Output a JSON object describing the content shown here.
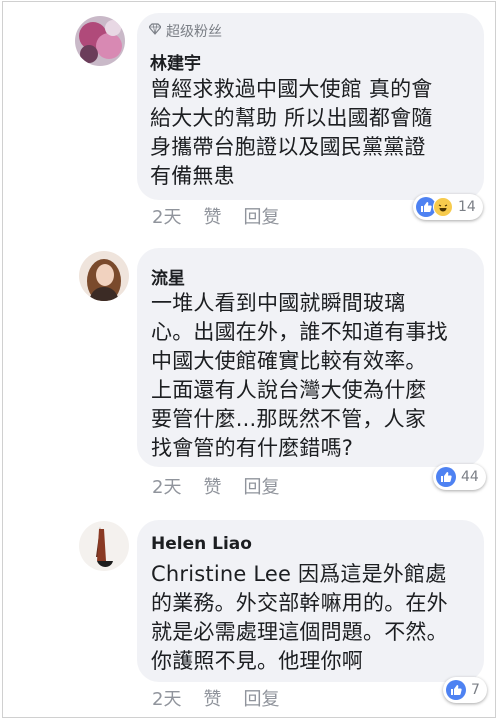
{
  "comments": [
    {
      "badge": "超级粉丝",
      "author": "林建宇",
      "text": "曾經求救過中國大使館 真的會\n給大大的幫助 所以出國都會隨\n身攜帶台胞證以及國民黨黨證\n有備無患",
      "time": "2天",
      "like_label": "赞",
      "reply_label": "回复",
      "reactions": [
        "like-icon",
        "haha-icon"
      ],
      "reaction_count": "14"
    },
    {
      "author": "流星",
      "text": "一堆人看到中國就瞬間玻璃\n心。出國在外，誰不知道有事找\n中國大使館確實比較有效率。\n上面還有人說台灣大使為什麼\n要管什麼...那既然不管，人家\n找會管的有什麼錯嗎?",
      "time": "2天",
      "like_label": "赞",
      "reply_label": "回复",
      "reactions": [
        "like-icon"
      ],
      "reaction_count": "44"
    },
    {
      "author": "Helen Liao",
      "text": "Christine Lee 因爲這是外館處\n的業務。外交部幹嘛用的。在外\n就是必需處理這個問題。不然。\n你護照不見。他理你啊",
      "time": "2天",
      "like_label": "赞",
      "reply_label": "回复",
      "reactions": [
        "like-icon"
      ],
      "reaction_count": "7"
    }
  ],
  "colors": {
    "bubble": "#f1f2f6",
    "like_blue": "#4e82f2",
    "muted_text": "#90949c"
  }
}
